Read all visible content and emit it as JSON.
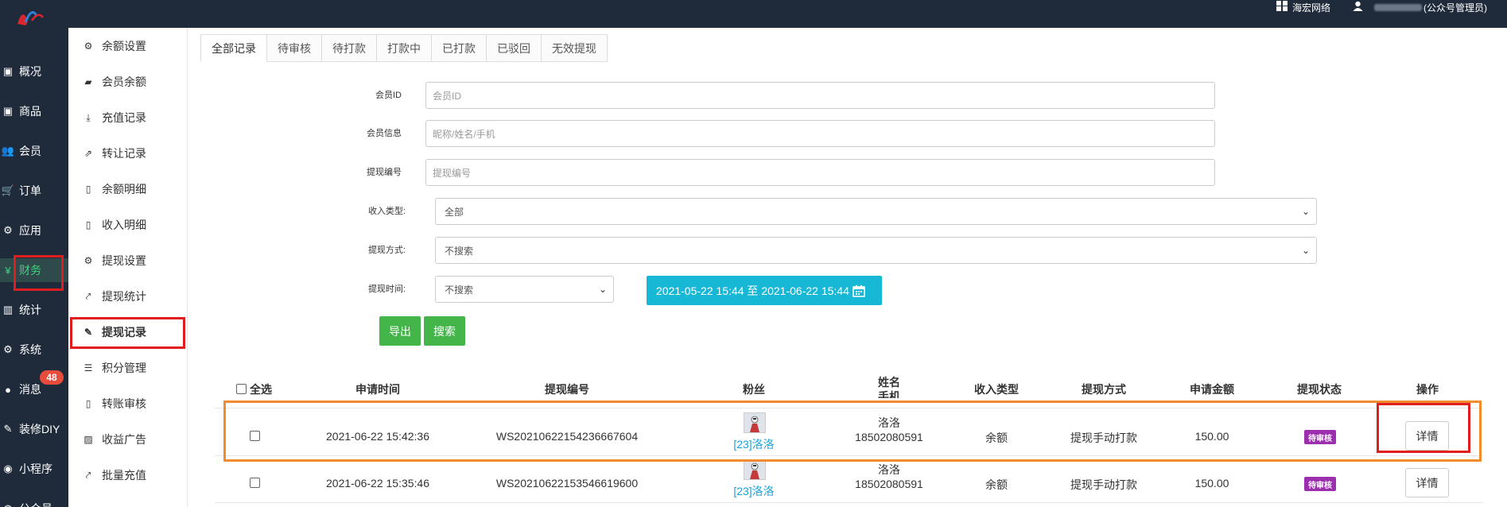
{
  "header": {
    "org_label": "海宏网络",
    "user_role": "(公众号管理员)"
  },
  "main_nav": [
    {
      "icon": "dashboard-icon",
      "label": "概况"
    },
    {
      "icon": "goods-icon",
      "label": "商品"
    },
    {
      "icon": "users-icon",
      "label": "会员"
    },
    {
      "icon": "cart-icon",
      "label": "订单"
    },
    {
      "icon": "apps-icon",
      "label": "应用"
    },
    {
      "icon": "yen-icon",
      "label": "财务"
    },
    {
      "icon": "stats-icon",
      "label": "统计"
    },
    {
      "icon": "gears-icon",
      "label": "系统"
    },
    {
      "icon": "comment-icon",
      "label": "消息"
    },
    {
      "icon": "brush-icon",
      "label": "装修DIY"
    },
    {
      "icon": "wechat-icon",
      "label": "小程序"
    },
    {
      "icon": "public-icon",
      "label": "公众号"
    }
  ],
  "message_badge": "48",
  "sub_nav": [
    {
      "icon": "gear-icon",
      "label": "余额设置"
    },
    {
      "icon": "book-icon",
      "label": "会员余额"
    },
    {
      "icon": "download-icon",
      "label": "充值记录"
    },
    {
      "icon": "external-link-icon",
      "label": "转让记录"
    },
    {
      "icon": "file-icon",
      "label": "余额明细"
    },
    {
      "icon": "file-icon",
      "label": "收入明细"
    },
    {
      "icon": "gear-icon",
      "label": "提现设置"
    },
    {
      "icon": "line-chart-icon",
      "label": "提现统计"
    },
    {
      "icon": "pencil-icon",
      "label": "提现记录"
    },
    {
      "icon": "database-icon",
      "label": "积分管理"
    },
    {
      "icon": "file-icon",
      "label": "转账审核"
    },
    {
      "icon": "image-icon",
      "label": "收益广告"
    },
    {
      "icon": "line-chart-icon",
      "label": "批量充值"
    }
  ],
  "tabs": [
    "全部记录",
    "待审核",
    "待打款",
    "打款中",
    "已打款",
    "已驳回",
    "无效提现"
  ],
  "filters": {
    "member_id_label": "会员ID",
    "member_id_placeholder": "会员ID",
    "member_info_label": "会员信息",
    "member_info_placeholder": "昵称/姓名/手机",
    "withdraw_no_label": "提现编号",
    "withdraw_no_placeholder": "提现编号",
    "income_type_label": "收入类型:",
    "income_type_value": "全部",
    "withdraw_method_label": "提现方式:",
    "withdraw_method_value": "不搜索",
    "withdraw_time_label": "提现时间:",
    "withdraw_time_value": "不搜索",
    "date_range": "2021-05-22 15:44 至 2021-06-22 15:44",
    "export_button": "导出",
    "search_button": "搜索"
  },
  "table": {
    "select_all": "全选",
    "headers": [
      "申请时间",
      "提现编号",
      "粉丝",
      "姓名",
      "手机",
      "收入类型",
      "提现方式",
      "申请金额",
      "提现状态",
      "操作"
    ],
    "rows": [
      {
        "time": "2021-06-22 15:42:36",
        "no": "WS20210622154236667604",
        "fan": "[23]洛洛",
        "name": "洛洛",
        "phone": "18502080591",
        "income_type": "余额",
        "method": "提现手动打款",
        "amount": "150.00",
        "status": "待审核",
        "action": "详情"
      },
      {
        "time": "2021-06-22 15:35:46",
        "no": "WS20210622153546619600",
        "fan": "[23]洛洛",
        "name": "洛洛",
        "phone": "18502080591",
        "income_type": "余额",
        "method": "提现手动打款",
        "amount": "150.00",
        "status": "待审核",
        "action": "详情"
      }
    ]
  },
  "colors": {
    "sidebar_bg": "#1f2b3a",
    "active_green": "#3fd37d",
    "highlight_red": "#e01e1e",
    "highlight_orange": "#f28a2e",
    "status_purple": "#9b2fae",
    "date_cyan": "#17b8d6",
    "button_green": "#44b549"
  }
}
